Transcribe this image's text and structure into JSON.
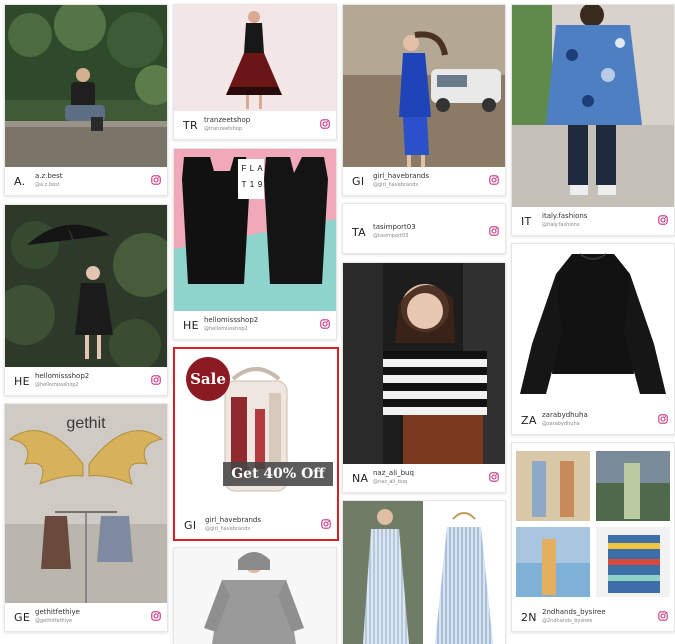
{
  "cards": [
    {
      "abbr": "A.",
      "username": "a.z.best",
      "handle": "@a.z.best"
    },
    {
      "abbr": "TR",
      "username": "tranzeetshop",
      "handle": "@tranzeetshop"
    },
    {
      "abbr": "GI",
      "username": "girl_havebrands",
      "handle": "@girl_havebrands"
    },
    {
      "abbr": "IT",
      "username": "italy.fashions",
      "handle": "@italy.fashions"
    },
    {
      "abbr": "HE",
      "username": "hellomissshop2",
      "handle": "@hellomissshop2"
    },
    {
      "abbr": "HE",
      "username": "hellomissshop2",
      "handle": "@hellomissshop2"
    },
    {
      "abbr": "TA",
      "username": "tasimport03",
      "handle": "@tasimport03"
    },
    {
      "abbr": "ZA",
      "username": "zarabydhuha",
      "handle": "@zarabydhuha"
    },
    {
      "abbr": "GE",
      "username": "gethitfethiye",
      "handle": "@gethitfethiye"
    },
    {
      "abbr": "GI",
      "username": "girl_havebrands",
      "handle": "@girl_havebrands"
    },
    {
      "abbr": "NA",
      "username": "naz_ali_buq",
      "handle": "@naz_ali_buq"
    },
    {
      "abbr": "2N",
      "username": "2ndhands_bysiree",
      "handle": "@2ndhands_bysiree"
    }
  ],
  "promo": {
    "sale": "Sale",
    "offer": "Get 40% Off"
  },
  "gethit": {
    "sign": "gethit"
  },
  "flat19": {
    "letters": [
      "F",
      "L",
      "A",
      "T",
      "1",
      "9"
    ]
  },
  "colors": {
    "selected_border": "#d81f26",
    "sale_badge": "#8b1a22",
    "instagram": "#c13584"
  }
}
